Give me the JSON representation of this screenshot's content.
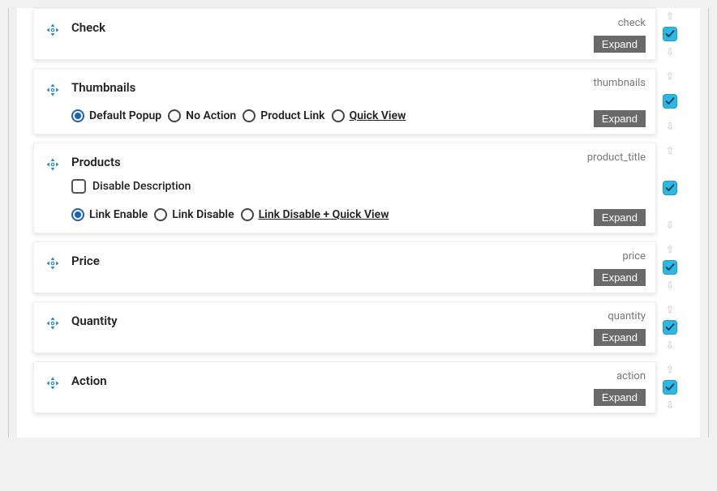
{
  "expand_label": "Expand",
  "panels": [
    {
      "id": "check",
      "title": "Check",
      "slug": "check",
      "enabled": true
    },
    {
      "id": "thumbnails",
      "title": "Thumbnails",
      "slug": "thumbnails",
      "enabled": true,
      "radios": {
        "group": "thumbnails_action",
        "selected": 0,
        "options": [
          {
            "label": "Default Popup"
          },
          {
            "label": "No Action"
          },
          {
            "label": "Product Link"
          },
          {
            "label": "Quick View",
            "underline": true
          }
        ]
      }
    },
    {
      "id": "products",
      "title": "Products",
      "slug": "product_title",
      "enabled": true,
      "checkbox": {
        "label": "Disable Description",
        "checked": false
      },
      "radios": {
        "group": "products_link",
        "selected": 0,
        "options": [
          {
            "label": "Link Enable"
          },
          {
            "label": "Link Disable"
          },
          {
            "label": "Link Disable + Quick View",
            "underline": true
          }
        ]
      }
    },
    {
      "id": "price",
      "title": "Price",
      "slug": "price",
      "enabled": true
    },
    {
      "id": "quantity",
      "title": "Quantity",
      "slug": "quantity",
      "enabled": true
    },
    {
      "id": "action",
      "title": "Action",
      "slug": "action",
      "enabled": true
    }
  ]
}
